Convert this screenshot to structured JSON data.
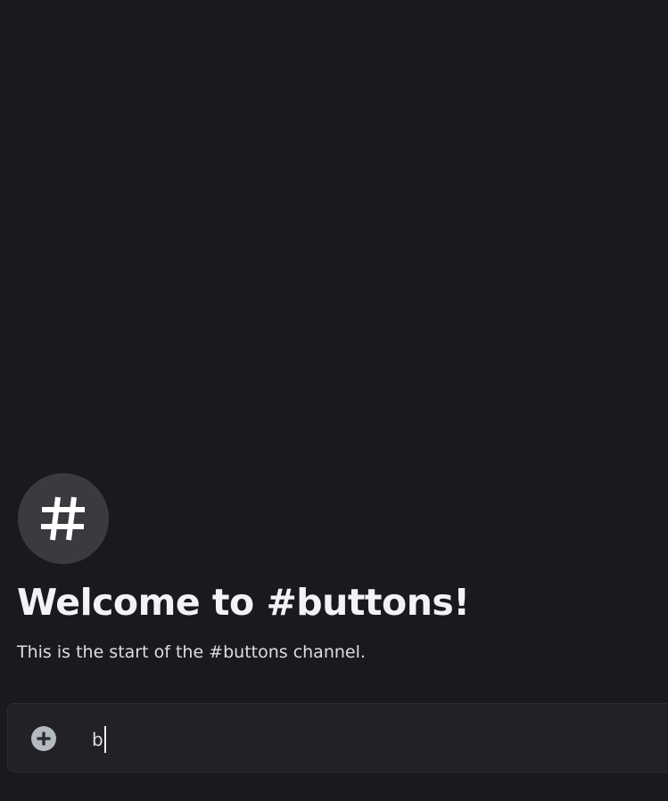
{
  "channel": {
    "icon": "hashtag-icon",
    "welcome_title": "Welcome to #buttons!",
    "welcome_subtitle": "This is the start of the #buttons channel."
  },
  "composer": {
    "attach_icon": "plus-circle-icon",
    "input_value": "b"
  },
  "colors": {
    "background": "#1a1a1e",
    "icon_circle": "#3a3b40",
    "title_text": "#f2f3f5",
    "body_text": "#dbdee1",
    "composer_background": "#222226",
    "attach_button": "#b5bac1"
  }
}
